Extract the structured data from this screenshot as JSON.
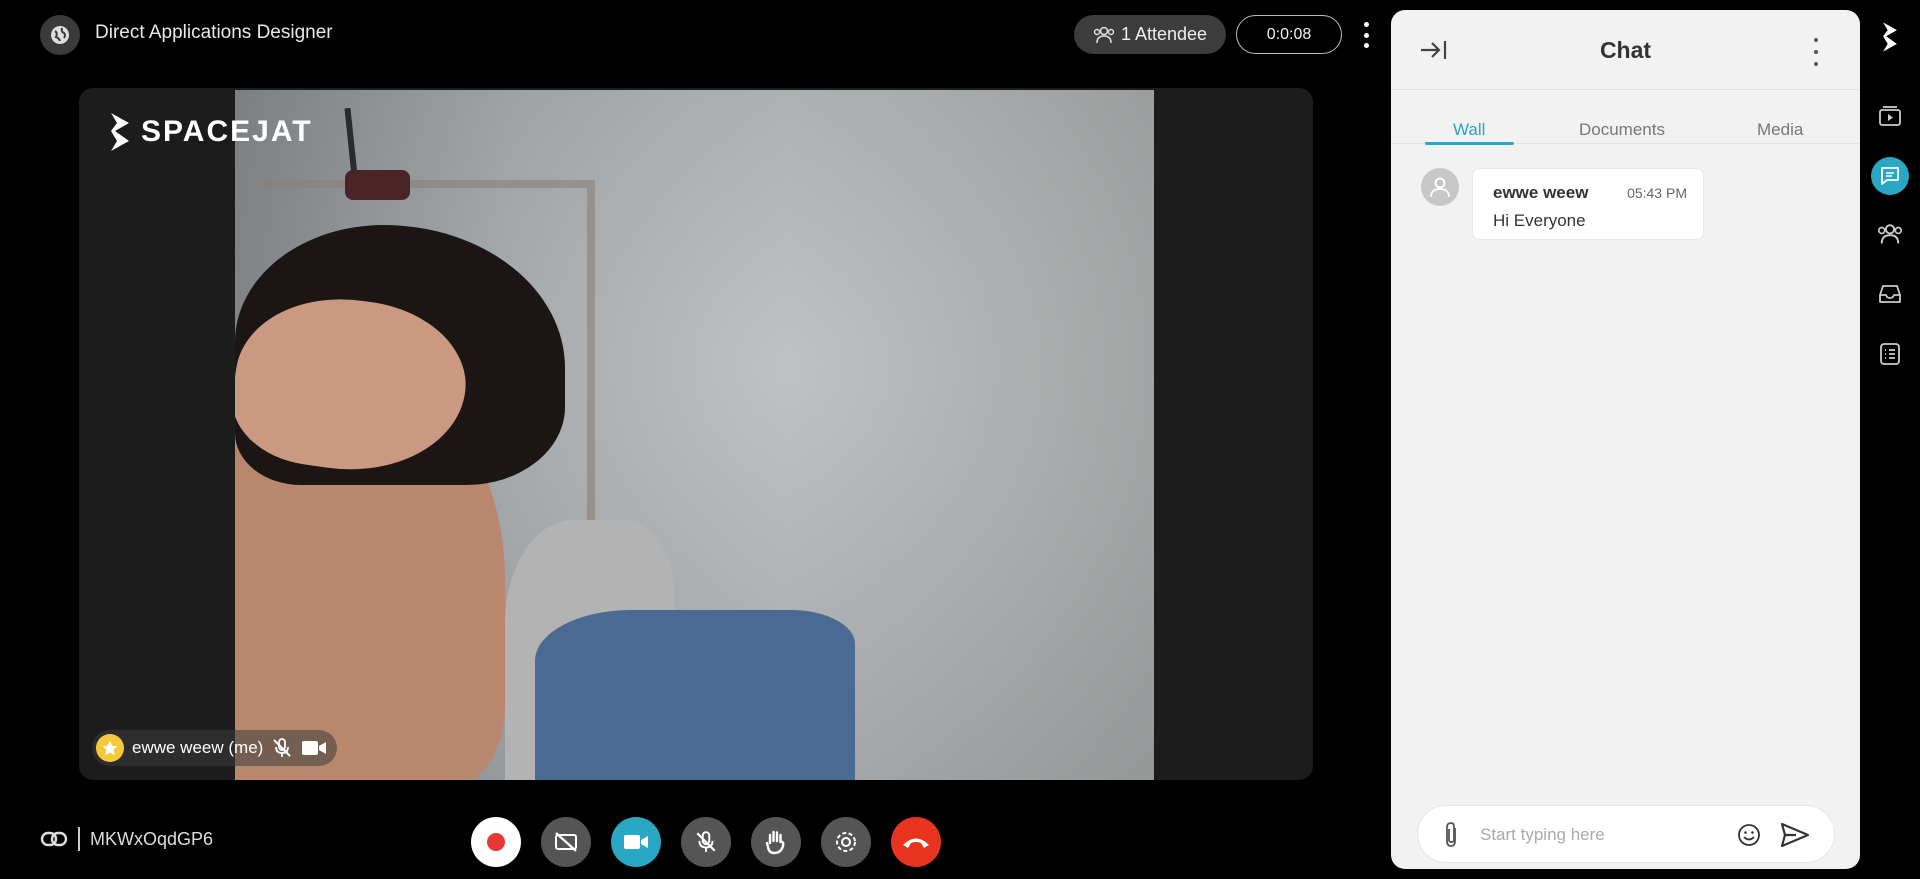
{
  "header": {
    "title": "Direct Applications Designer",
    "attendees_label": "1 Attendee",
    "timer": "0:0:08"
  },
  "video": {
    "brand": "SPACEJAT",
    "participant_label": "ewwe weew (me)"
  },
  "footer": {
    "meeting_code": "MKWxOqdGP6"
  },
  "chat": {
    "title": "Chat",
    "tabs": [
      {
        "label": "Wall",
        "active": true
      },
      {
        "label": "Documents",
        "active": false
      },
      {
        "label": "Media",
        "active": false
      }
    ],
    "messages": [
      {
        "author": "ewwe weew",
        "time": "05:43 PM",
        "text": "Hi Everyone"
      }
    ],
    "composer_placeholder": "Start typing here"
  },
  "colors": {
    "accent": "#2aa7c2",
    "record": "#e53935",
    "hangup": "#e8331f",
    "star": "#f6c93b"
  },
  "icons": {
    "controls": [
      "record-icon",
      "camera-off-icon",
      "camera-icon",
      "mic-off-icon",
      "raise-hand-icon",
      "settings-icon",
      "hangup-icon"
    ],
    "rail": [
      "logo-icon",
      "media-play-icon",
      "chat-icon",
      "people-icon",
      "inbox-icon",
      "list-icon"
    ]
  }
}
